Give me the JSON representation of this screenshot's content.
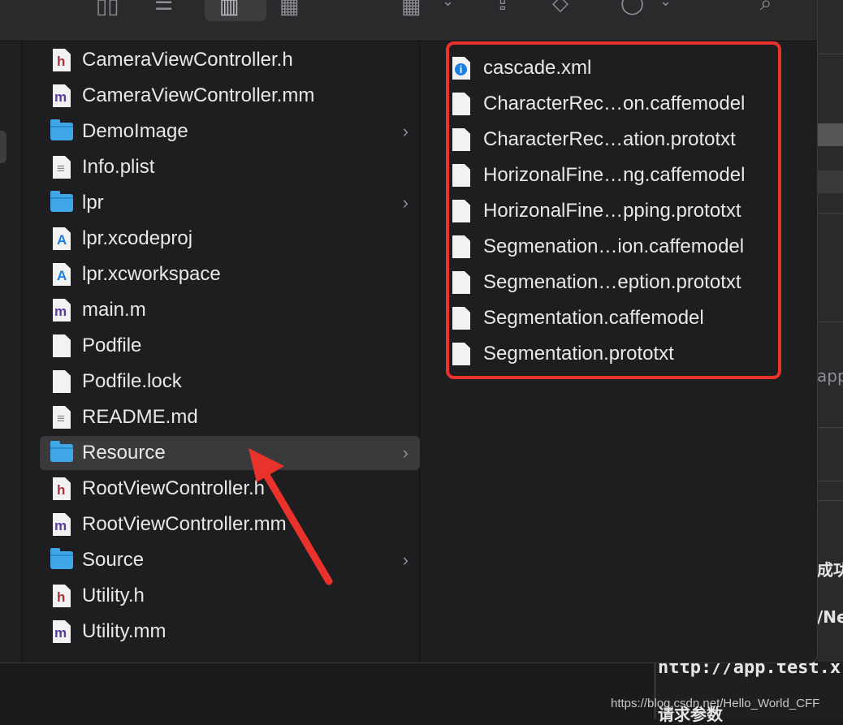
{
  "left_column": [
    {
      "label": "CameraViewController.h",
      "icon": "h-header-file-icon",
      "folder": false
    },
    {
      "label": "CameraViewController.mm",
      "icon": "m-source-file-icon",
      "folder": false
    },
    {
      "label": "DemoImage",
      "icon": "folder-icon",
      "folder": true
    },
    {
      "label": "Info.plist",
      "icon": "plist-file-icon",
      "folder": false
    },
    {
      "label": "lpr",
      "icon": "folder-icon",
      "folder": true
    },
    {
      "label": "lpr.xcodeproj",
      "icon": "xcodeproj-icon",
      "folder": false
    },
    {
      "label": "lpr.xcworkspace",
      "icon": "xcworkspace-icon",
      "folder": false
    },
    {
      "label": "main.m",
      "icon": "m-source-file-icon",
      "folder": false
    },
    {
      "label": "Podfile",
      "icon": "blank-document-icon",
      "folder": false
    },
    {
      "label": "Podfile.lock",
      "icon": "blank-document-icon",
      "folder": false
    },
    {
      "label": "README.md",
      "icon": "text-document-icon",
      "folder": false
    },
    {
      "label": "Resource",
      "icon": "folder-icon",
      "folder": true,
      "selected": true
    },
    {
      "label": "RootViewController.h",
      "icon": "h-header-file-icon",
      "folder": false
    },
    {
      "label": "RootViewController.mm",
      "icon": "m-source-file-icon",
      "folder": false
    },
    {
      "label": "Source",
      "icon": "folder-icon",
      "folder": true
    },
    {
      "label": "Utility.h",
      "icon": "h-header-file-icon",
      "folder": false
    },
    {
      "label": "Utility.mm",
      "icon": "m-source-file-icon",
      "folder": false
    }
  ],
  "right_column": [
    {
      "label": "cascade.xml",
      "icon": "xml-file-icon"
    },
    {
      "label": "CharacterRec…on.caffemodel",
      "icon": "blank-document-icon"
    },
    {
      "label": "CharacterRec…ation.prototxt",
      "icon": "blank-document-icon"
    },
    {
      "label": "HorizonalFine…ng.caffemodel",
      "icon": "blank-document-icon"
    },
    {
      "label": "HorizonalFine…pping.prototxt",
      "icon": "blank-document-icon"
    },
    {
      "label": "Segmenation…ion.caffemodel",
      "icon": "blank-document-icon"
    },
    {
      "label": "Segmenation…eption.prototxt",
      "icon": "blank-document-icon"
    },
    {
      "label": "Segmentation.caffemodel",
      "icon": "blank-document-icon"
    },
    {
      "label": "Segmentation.prototxt",
      "icon": "blank-document-icon"
    }
  ],
  "background": {
    "text_1": "app",
    "text_2": "成功",
    "text_3": "/Ne",
    "text_4": "http://app.test.x",
    "text_5": "请求参数"
  },
  "watermark": "https://blog.csdn.net/Hello_World_CFF",
  "colors": {
    "highlight_border": "#e8322b",
    "arrow": "#e8322b",
    "folder": "#3fa7e8",
    "selection": "#3a3a3d"
  }
}
